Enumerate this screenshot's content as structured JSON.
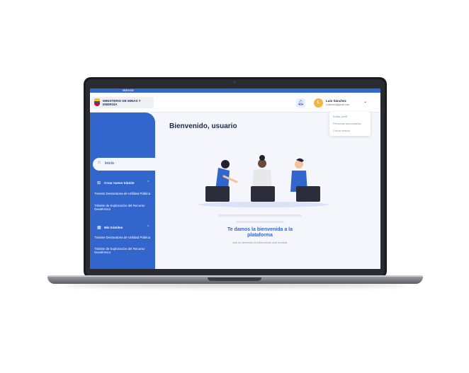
{
  "gov_bar": {
    "logo": "GOV.CO"
  },
  "header": {
    "ministry": "MINISTERIO DE MINAS Y ENERGÍA",
    "user_name": "Luis Sánchez",
    "user_email": "Luischez@gmail.com",
    "avatar_initial": "L"
  },
  "user_menu": {
    "items": [
      "Editar perfil",
      "Personas secundarias",
      "Cerrar sesión"
    ]
  },
  "sidebar": {
    "home": "Inicio",
    "sections": [
      {
        "title": "Crear nuevo trámite",
        "items": [
          "Tramite Declaratoria de Utilidad Pública",
          "Trámite de Exploración del Recurso Geotérmico"
        ]
      },
      {
        "title": "Mis trámites",
        "items": [
          "Tramite Declaratoria de Utilidad Pública",
          "Trámite de Exploración del Recurso Geotérmico"
        ]
      }
    ]
  },
  "main": {
    "greeting": "Bienvenido, usuario",
    "message_title": "Te damos la bienvenida a la plataforma",
    "message_subtitle": "aun no tenemos la informacion que mostrar"
  },
  "colors": {
    "primary": "#3366cc",
    "background": "#f4f6fb",
    "avatar": "#f2b640"
  }
}
